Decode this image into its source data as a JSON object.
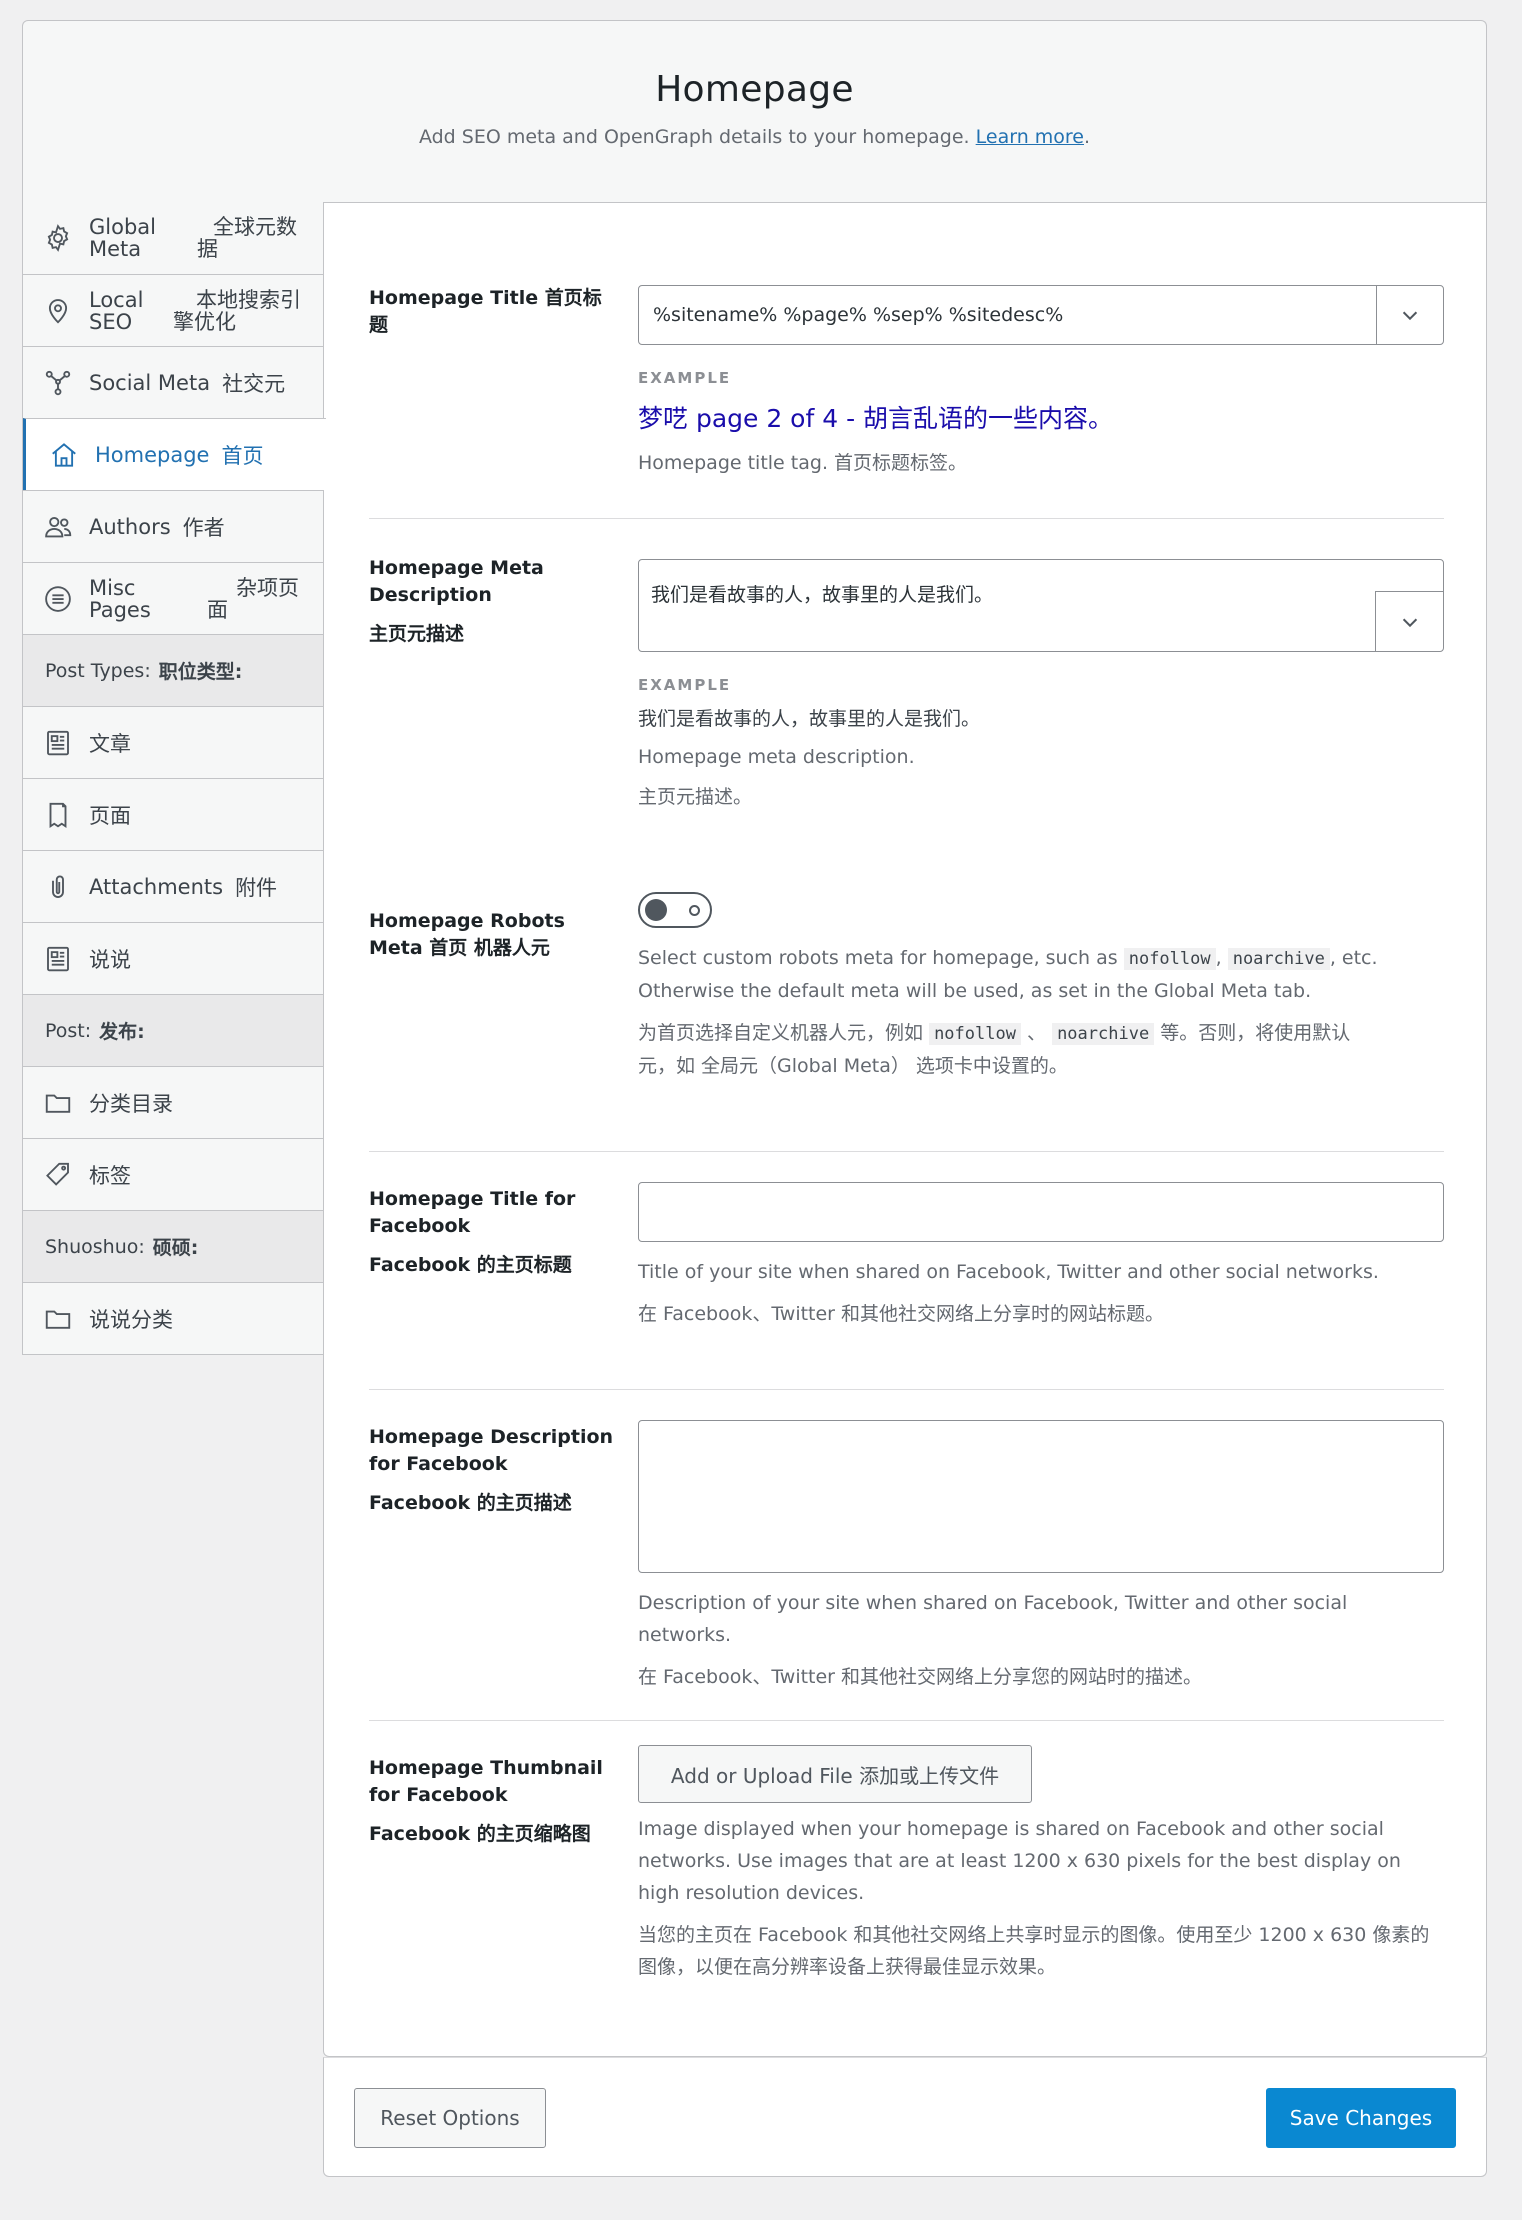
{
  "header": {
    "title": "Homepage",
    "subtitle": "Add SEO meta and OpenGraph details to your homepage.",
    "learn_more": "Learn more",
    "period": "."
  },
  "sidebar": {
    "items": [
      {
        "en": "Global Meta",
        "en1": "Global",
        "en2": "Meta",
        "zh1": "全球元数",
        "zh2": "据",
        "icon": "gear-icon"
      },
      {
        "en": "Local SEO",
        "en1": "Local",
        "en2": "SEO",
        "zh1": "本地搜索引",
        "zh2": "擎优化",
        "icon": "map-pin-icon"
      },
      {
        "en": "Social Meta",
        "zh": "社交元",
        "icon": "share-network-icon"
      },
      {
        "en": "Homepage",
        "zh": "首页",
        "icon": "home-icon"
      },
      {
        "en": "Authors",
        "zh": "作者",
        "icon": "users-icon"
      },
      {
        "en": "Misc Pages",
        "en1": "Misc",
        "en2": "Pages",
        "zh1": "杂项页",
        "zh2": "面",
        "icon": "circle-lines-icon"
      }
    ],
    "post_types": {
      "en": "Post Types:",
      "zh": "职位类型:"
    },
    "post_type_items": [
      {
        "label": "文章",
        "icon": "document-icon"
      },
      {
        "label": "页面",
        "icon": "page-icon"
      },
      {
        "en": "Attachments",
        "zh": "附件",
        "icon": "paperclip-icon"
      },
      {
        "label": "说说",
        "icon": "document-icon"
      }
    ],
    "post": {
      "en": "Post:",
      "zh": "发布:"
    },
    "post_items": [
      {
        "label": "分类目录",
        "icon": "folder-icon"
      },
      {
        "label": "标签",
        "icon": "tag-icon"
      }
    ],
    "shuoshuo": {
      "en": "Shuoshuo:",
      "zh": "硕硕:"
    },
    "shuoshuo_items": [
      {
        "label": "说说分类",
        "icon": "folder-icon"
      }
    ]
  },
  "fields": {
    "title": {
      "label": "Homepage Title 首页标题",
      "value": "%sitename% %page% %sep% %sitedesc%",
      "example_tag": "EXAMPLE",
      "example": "梦呓 page 2 of 4 - 胡言乱语的一些内容。",
      "help": "Homepage title tag. 首页标题标签。"
    },
    "meta_description": {
      "label": "Homepage Meta Description",
      "label_zh": "主页元描述",
      "value": "我们是看故事的人，故事里的人是我们。",
      "example_tag": "EXAMPLE",
      "example": "我们是看故事的人，故事里的人是我们。",
      "help": "Homepage meta description.",
      "help_zh": "主页元描述。"
    },
    "robots": {
      "label": "Homepage Robots Meta 首页 机器人元",
      "help_1": "Select custom robots meta for homepage, such as",
      "code_1": "nofollow",
      "sep_1": ",",
      "code_2": "noarchive",
      "help_2": ", etc.",
      "help_3": "Otherwise the default meta will be used, as set in the Global Meta tab.",
      "zh_1": "为首页选择自定义机器人元，例如",
      "zh_sep": "、",
      "zh_2": "等。否则，将使用默认",
      "zh_3": "元，如 全局元（Global Meta） 选项卡中设置的。"
    },
    "fb_title": {
      "label": "Homepage Title for Facebook",
      "label_zh": "Facebook 的主页标题",
      "help": "Title of your site when shared on Facebook, Twitter and other social networks.",
      "help_zh": "在 Facebook、Twitter 和其他社交网络上分享时的网站标题。"
    },
    "fb_description": {
      "label": "Homepage Description for Facebook",
      "label_zh": "Facebook 的主页描述",
      "help": "Description of your site when shared on Facebook, Twitter and other social networks.",
      "help_zh": "在 Facebook、Twitter 和其他社交网络上分享您的网站时的描述。"
    },
    "fb_thumbnail": {
      "label": "Homepage Thumbnail for Facebook",
      "label_zh": "Facebook 的主页缩略图",
      "button": "Add or Upload File 添加或上传文件",
      "help": "Image displayed when your homepage is shared on Facebook and other social networks. Use images that are at least 1200 x 630 pixels for the best display on high resolution devices.",
      "help_zh": "当您的主页在 Facebook 和其他社交网络上共享时显示的图像。使用至少 1200 x 630 像素的图像，以便在高分辨率设备上获得最佳显示效果。"
    }
  },
  "footer": {
    "reset": "Reset Options",
    "save": "Save Changes"
  },
  "colors": {
    "accent": "#2271b1",
    "primary_button": "#0a88d1",
    "example_link": "#1a0dab"
  }
}
